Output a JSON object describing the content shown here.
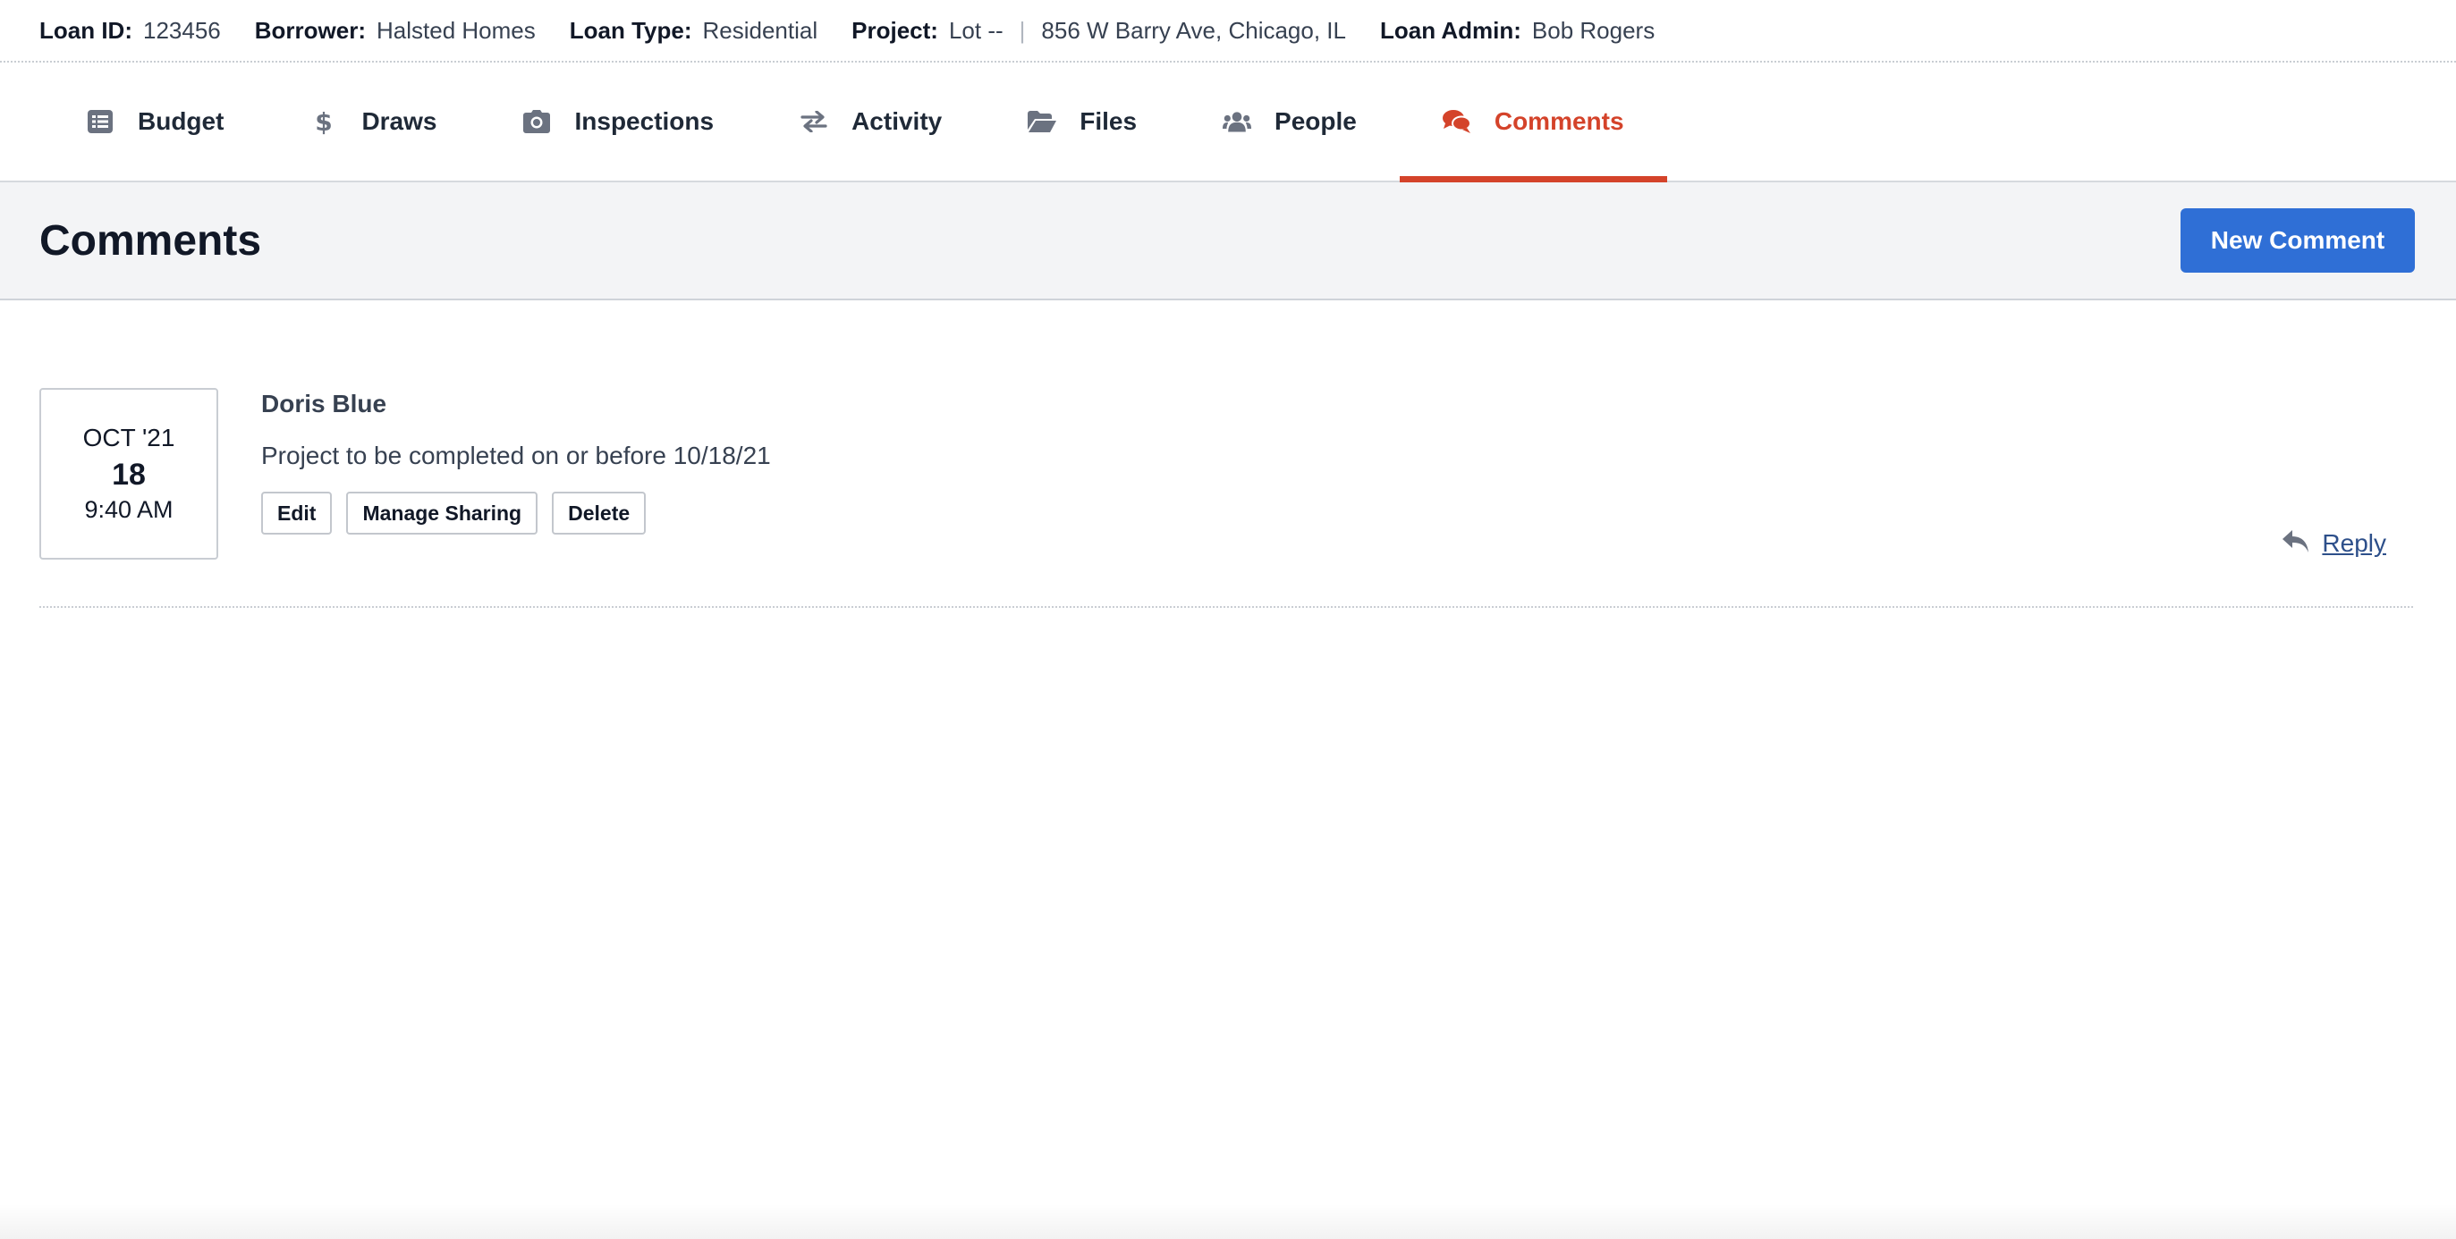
{
  "loan_info": {
    "loan_id_label": "Loan ID:",
    "loan_id": "123456",
    "borrower_label": "Borrower:",
    "borrower": "Halsted Homes",
    "loan_type_label": "Loan Type:",
    "loan_type": "Residential",
    "project_label": "Project:",
    "project_lot": "Lot --",
    "project_separator": "|",
    "project_address": "856 W Barry Ave, Chicago, IL",
    "loan_admin_label": "Loan Admin:",
    "loan_admin": "Bob Rogers"
  },
  "tabs": [
    {
      "label": "Budget",
      "icon": "list-icon"
    },
    {
      "label": "Draws",
      "icon": "dollar-icon"
    },
    {
      "label": "Inspections",
      "icon": "camera-icon"
    },
    {
      "label": "Activity",
      "icon": "exchange-icon"
    },
    {
      "label": "Files",
      "icon": "folder-open-icon"
    },
    {
      "label": "People",
      "icon": "users-icon"
    },
    {
      "label": "Comments",
      "icon": "comments-icon",
      "active": true
    }
  ],
  "section": {
    "title": "Comments",
    "new_button": "New Comment"
  },
  "comment": {
    "date_month": "OCT '21",
    "date_day": "18",
    "date_time": "9:40 AM",
    "author": "Doris Blue",
    "text": "Project to be completed on or before 10/18/21",
    "actions": [
      "Edit",
      "Manage Sharing",
      "Delete"
    ],
    "reply_label": "Reply"
  },
  "colors": {
    "accent_active": "#d4432a",
    "primary_button": "#2f6fd6",
    "link": "#2d4f8a"
  }
}
